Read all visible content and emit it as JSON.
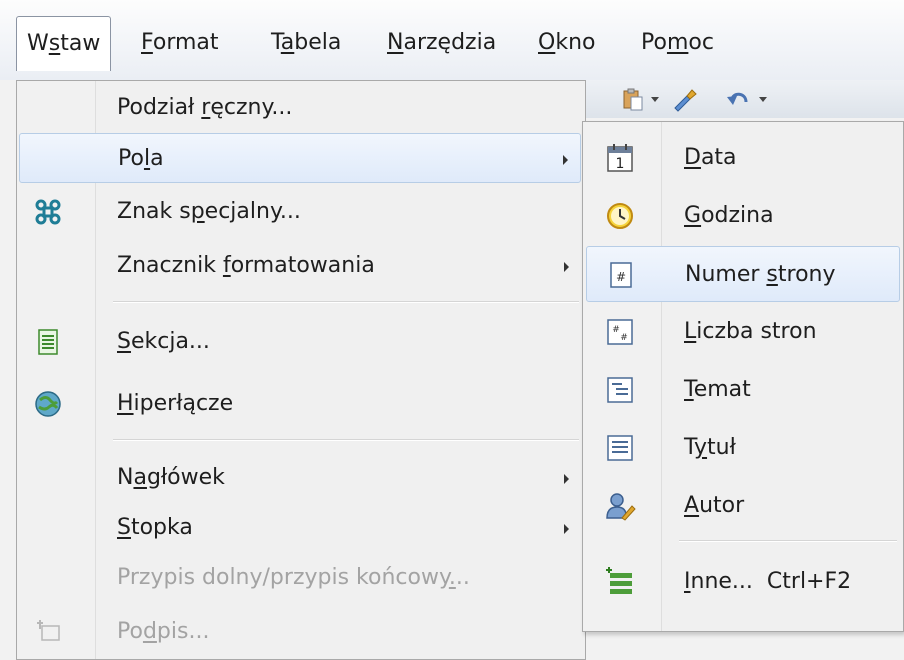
{
  "menubar": {
    "items": [
      {
        "pre": "W",
        "key": "s",
        "post": "taw"
      },
      {
        "pre": "",
        "key": "F",
        "post": "ormat"
      },
      {
        "pre": "T",
        "key": "a",
        "post": "bela"
      },
      {
        "pre": "",
        "key": "N",
        "post": "arzędzia"
      },
      {
        "pre": "",
        "key": "O",
        "post": "kno"
      },
      {
        "pre": "Po",
        "key": "m",
        "post": "oc"
      }
    ]
  },
  "insert_menu": {
    "items": [
      {
        "pre": "Podział ",
        "key": "r",
        "post": "ęczny...",
        "icon": "",
        "submenu": false,
        "enabled": true
      },
      {
        "pre": "Po",
        "key": "l",
        "post": "a",
        "icon": "",
        "submenu": true,
        "enabled": true
      },
      {
        "pre": "Znak s",
        "key": "p",
        "post": "ecjalny...",
        "icon": "special-character-icon",
        "submenu": false,
        "enabled": true
      },
      {
        "pre": "Znacznik ",
        "key": "f",
        "post": "ormatowania",
        "icon": "",
        "submenu": true,
        "enabled": true
      },
      {
        "pre": "",
        "key": "S",
        "post": "ekcja...",
        "icon": "section-icon",
        "submenu": false,
        "enabled": true
      },
      {
        "pre": "",
        "key": "H",
        "post": "iperłącze",
        "icon": "hyperlink-icon",
        "submenu": false,
        "enabled": true
      },
      {
        "pre": "N",
        "key": "a",
        "post": "główek",
        "icon": "",
        "submenu": true,
        "enabled": true
      },
      {
        "pre": "",
        "key": "S",
        "post": "topka",
        "icon": "",
        "submenu": true,
        "enabled": true
      },
      {
        "pre": "Przypis dolny/przypis końcowy",
        "key": ".",
        "post": "..",
        "icon": "",
        "submenu": false,
        "enabled": false
      },
      {
        "pre": "Po",
        "key": "d",
        "post": "pis...",
        "icon": "caption-icon",
        "submenu": false,
        "enabled": false
      }
    ]
  },
  "fields_submenu": {
    "items": [
      {
        "pre": "",
        "key": "D",
        "post": "ata",
        "icon": "calendar-icon"
      },
      {
        "pre": "",
        "key": "G",
        "post": "odzina",
        "icon": "clock-icon"
      },
      {
        "pre": "Numer ",
        "key": "s",
        "post": "trony",
        "icon": "page-number-icon"
      },
      {
        "pre": "",
        "key": "L",
        "post": "iczba stron",
        "icon": "page-count-icon"
      },
      {
        "pre": "",
        "key": "T",
        "post": "emat",
        "icon": "subject-icon"
      },
      {
        "pre": "T",
        "key": "y",
        "post": "tuł",
        "icon": "title-icon"
      },
      {
        "pre": "",
        "key": "A",
        "post": "utor",
        "icon": "author-icon"
      },
      {
        "pre": "",
        "key": "I",
        "post": "nne...",
        "shortcut": "Ctrl+F2",
        "icon": "more-fields-icon"
      }
    ]
  },
  "colors": {
    "highlight_top": "#f1f6fd",
    "highlight_bottom": "#dfeafa",
    "highlight_border": "#b7cde6",
    "disabled_text": "#a3a3a3"
  }
}
